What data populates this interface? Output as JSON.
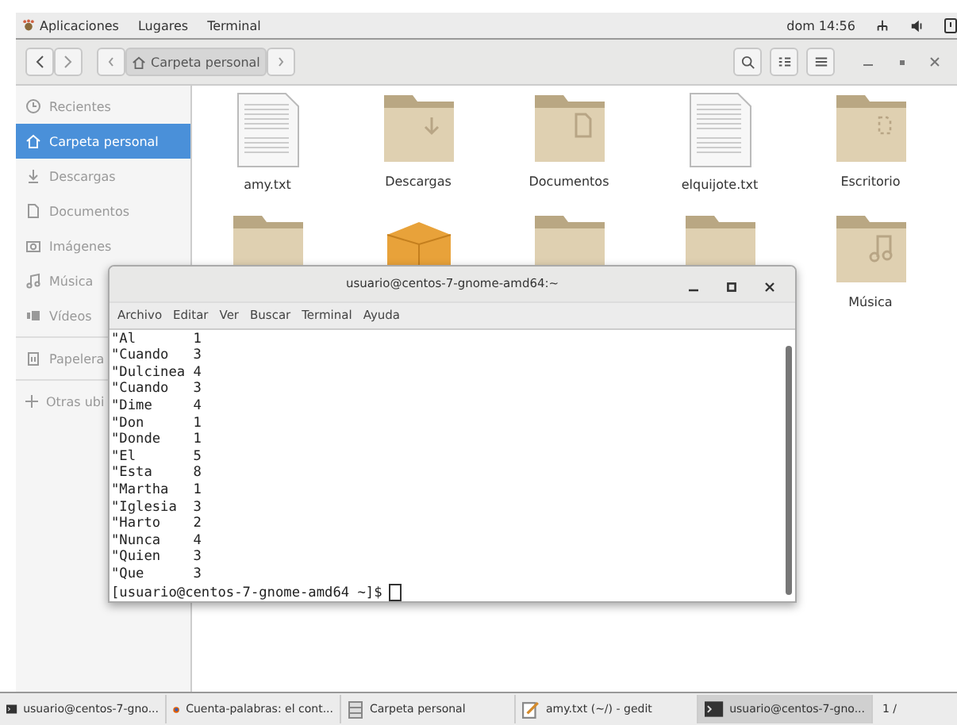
{
  "top_bar": {
    "menus": [
      "Aplicaciones",
      "Lugares",
      "Terminal"
    ],
    "clock": "dom 14:56"
  },
  "header_bar": {
    "path": [
      {
        "label": "Carpeta personal",
        "selected": true
      }
    ]
  },
  "sidebar": {
    "items": [
      {
        "label": "Recientes",
        "selected": false
      },
      {
        "label": "Carpeta personal",
        "selected": true
      },
      {
        "label": "Descargas",
        "selected": false
      },
      {
        "label": "Documentos",
        "selected": false
      },
      {
        "label": "Imágenes",
        "selected": false
      },
      {
        "label": "Música",
        "selected": false
      },
      {
        "label": "Vídeos",
        "selected": false
      },
      {
        "label": "Papelera",
        "selected": false
      }
    ],
    "other": "Otras ubi"
  },
  "files": [
    {
      "label": "amy.txt",
      "kind": "text"
    },
    {
      "label": "Descargas",
      "kind": "downloads"
    },
    {
      "label": "Documentos",
      "kind": "documents"
    },
    {
      "label": "elquijote.txt",
      "kind": "text"
    },
    {
      "label": "Escritorio",
      "kind": "desktop"
    },
    {
      "kind": "folder"
    },
    {
      "kind": "package"
    },
    {
      "kind": "folder"
    },
    {
      "kind": "folder"
    },
    {
      "label": "Música",
      "kind": "music"
    }
  ],
  "terminal": {
    "title": "usuario@centos-7-gnome-amd64:~",
    "menus": [
      "Archivo",
      "Editar",
      "Ver",
      "Buscar",
      "Terminal",
      "Ayuda"
    ],
    "lines": [
      "\"Al       1",
      "\"Cuando   3",
      "\"Dulcinea 4",
      "\"Cuando   3",
      "\"Dime     4",
      "\"Don      1",
      "\"Donde    1",
      "\"El       5",
      "\"Esta     8",
      "\"Martha   1",
      "\"Iglesia  3",
      "\"Harto    2",
      "\"Nunca    4",
      "\"Quien    3",
      "\"Que      3"
    ],
    "prompt": "[usuario@centos-7-gnome-amd64 ~]$"
  },
  "taskbar": {
    "items": [
      {
        "label": "usuario@centos-7-gno...",
        "kind": "terminal",
        "selected": false
      },
      {
        "label": "Cuenta-palabras: el cont...",
        "kind": "browser",
        "selected": false
      },
      {
        "label": "Carpeta personal",
        "kind": "files",
        "selected": false
      },
      {
        "label": "amy.txt (~/) - gedit",
        "kind": "editor",
        "selected": false
      },
      {
        "label": "usuario@centos-7-gno...",
        "kind": "terminal",
        "selected": true
      }
    ],
    "pager": "1 /"
  }
}
